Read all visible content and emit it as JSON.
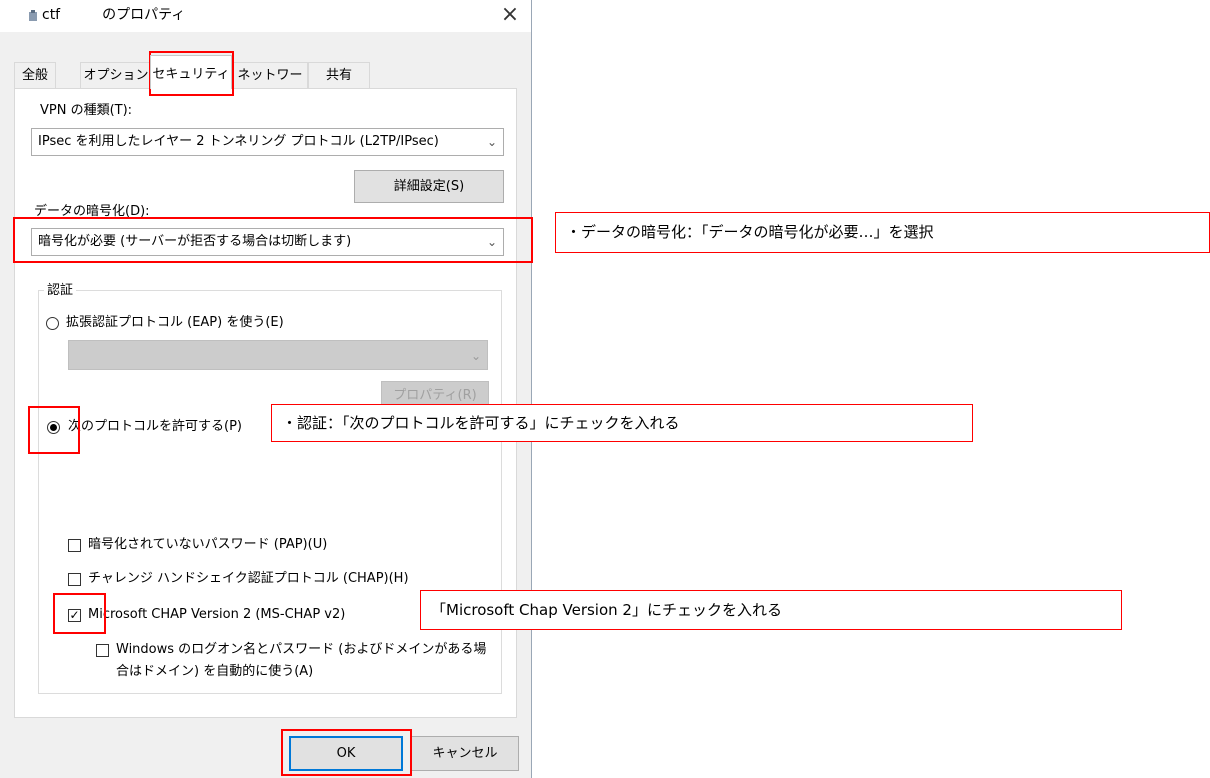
{
  "window": {
    "title_prefix": "ctf",
    "title_suffix": "のプロパティ",
    "close_icon": "×"
  },
  "tabs": [
    {
      "label": "全般"
    },
    {
      "label": "オプション"
    },
    {
      "label": "セキュリティ",
      "active": true
    },
    {
      "label": "ネットワーク"
    },
    {
      "label": "共有"
    }
  ],
  "security": {
    "vpn_type_label": "VPN の種類(T):",
    "vpn_type_value": "IPsec を利用したレイヤー 2 トンネリング プロトコル (L2TP/IPsec)",
    "advanced_button": "詳細設定(S)",
    "encryption_label": "データの暗号化(D):",
    "encryption_value": "暗号化が必要 (サーバーが拒否する場合は切断します)"
  },
  "auth": {
    "group_label": "認証",
    "eap_radio_label": "拡張認証プロトコル (EAP) を使う(E)",
    "eap_selected": false,
    "eap_combo_value": "",
    "properties_button": "プロパティ(R)",
    "allow_radio_label": "次のプロトコルを許可する(P)",
    "allow_selected": true,
    "pap_label": "暗号化されていないパスワード (PAP)(U)",
    "pap_checked": false,
    "chap_label": "チャレンジ ハンドシェイク認証プロトコル (CHAP)(H)",
    "chap_checked": false,
    "mschap_label": "Microsoft CHAP Version 2 (MS-CHAP v2)",
    "mschap_checked": true,
    "windows_logon_line1": "Windows のログオン名とパスワード (およびドメインがある場",
    "windows_logon_line2": "合はドメイン) を自動的に使う(A)",
    "windows_logon_checked": false
  },
  "footer": {
    "ok_button": "OK",
    "cancel_button": "キャンセル"
  },
  "annotations": {
    "encryption_note": "・データの暗号化：「データの暗号化が必要…」を選択",
    "auth_note": "・認証：「次のプロトコルを許可する」にチェックを入れる",
    "mschap_note": "「Microsoft Chap Version 2」にチェックを入れる",
    "highlight_color": "#ff0000"
  },
  "icons": {
    "dropdown": "chevron-down-icon",
    "check": "checkmark-icon",
    "close": "close-icon",
    "network": "network-connection-icon"
  }
}
